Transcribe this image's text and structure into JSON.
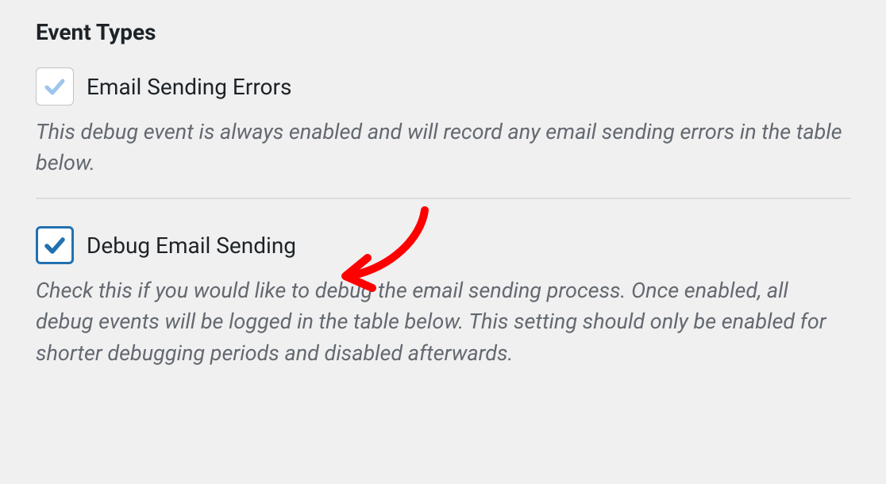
{
  "section": {
    "heading": "Event Types"
  },
  "options": {
    "emailSendingErrors": {
      "label": "Email Sending Errors",
      "description": "This debug event is always enabled and will record any email sending errors in the table below."
    },
    "debugEmailSending": {
      "label": "Debug Email Sending",
      "description": "Check this if you would like to debug the email sending process. Once enabled, all debug events will be logged in the table below. This setting should only be enabled for shorter debugging periods and disabled afterwards."
    }
  }
}
